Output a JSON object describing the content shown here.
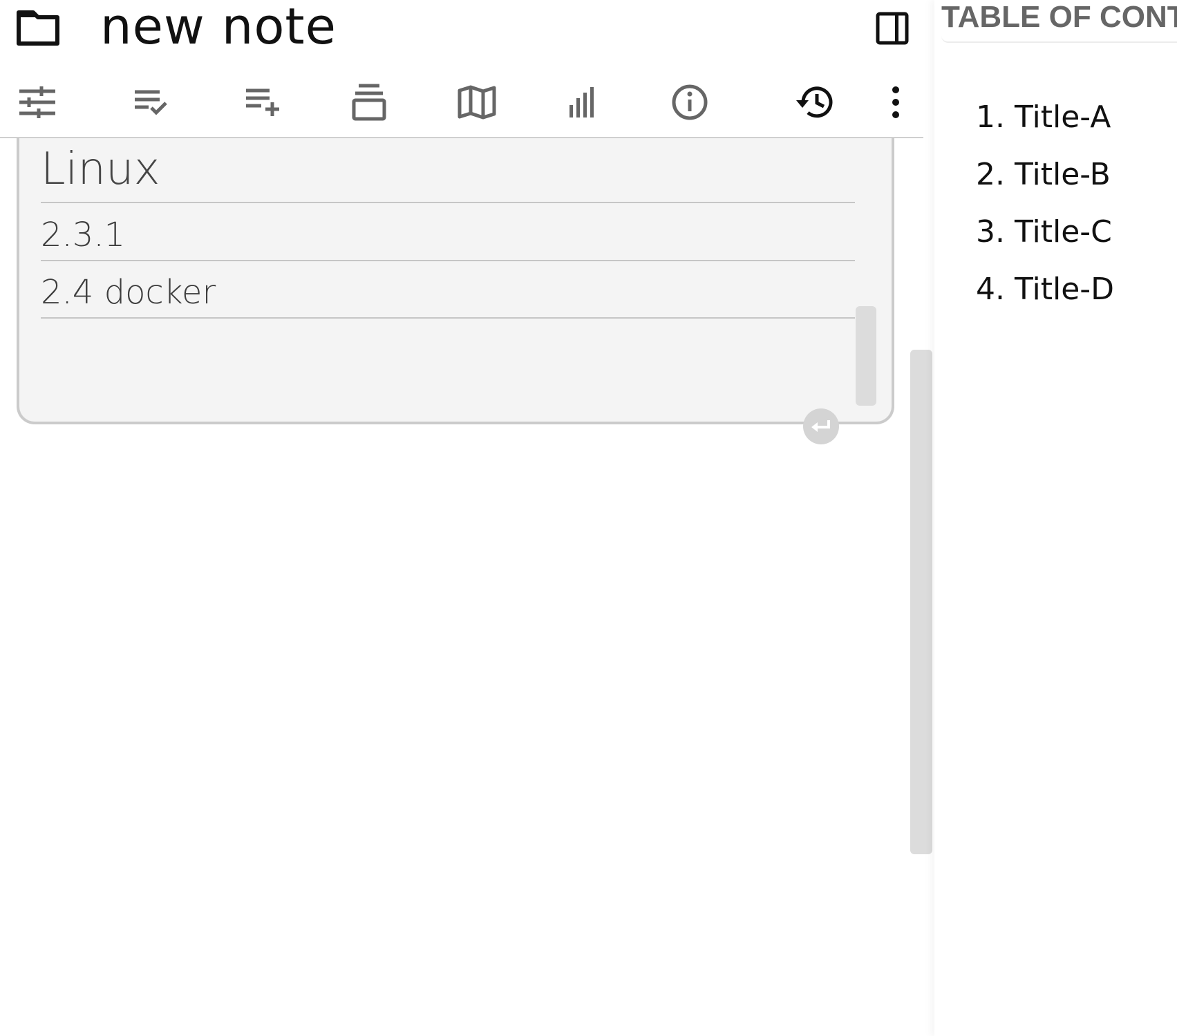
{
  "header": {
    "title": "new note",
    "folder_icon": "folder-icon",
    "sidebar_toggle_icon": "panel-right-icon"
  },
  "toolbar": {
    "buttons": [
      {
        "name": "settings-sliders-button",
        "icon": "tune-icon"
      },
      {
        "name": "checklist-button",
        "icon": "list-check-icon"
      },
      {
        "name": "add-list-button",
        "icon": "playlist-add-icon"
      },
      {
        "name": "layers-button",
        "icon": "layers-icon"
      },
      {
        "name": "map-button",
        "icon": "map-icon"
      },
      {
        "name": "stats-button",
        "icon": "bar-chart-icon"
      },
      {
        "name": "info-button",
        "icon": "info-icon"
      },
      {
        "name": "history-button",
        "icon": "history-icon"
      },
      {
        "name": "more-menu-button",
        "icon": "more-vertical-icon"
      }
    ]
  },
  "editor": {
    "lines": [
      {
        "text": "Linux"
      },
      {
        "text": "2.3.1"
      },
      {
        "text": "2.4 docker"
      }
    ],
    "enter_icon": "return-icon"
  },
  "toc": {
    "title": "TABLE OF CONTENTS",
    "items": [
      {
        "num": "1.",
        "label": "Title-A"
      },
      {
        "num": "2.",
        "label": "Title-B"
      },
      {
        "num": "3.",
        "label": "Title-C"
      },
      {
        "num": "4.",
        "label": "Title-D"
      }
    ]
  },
  "colors": {
    "card_background": "#f4f4f4",
    "card_border": "#cbcbcb",
    "icon_gray": "#666666",
    "scrollbar": "#dcdcdc"
  }
}
